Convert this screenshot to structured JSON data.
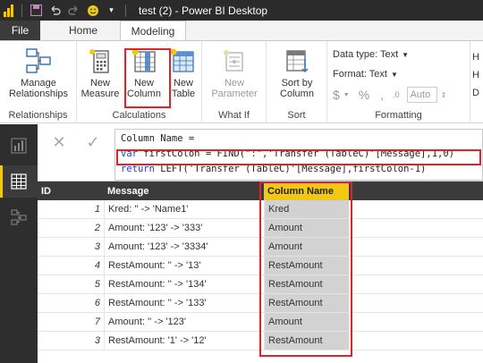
{
  "window": {
    "title": "test (2) - Power BI Desktop"
  },
  "tabs": {
    "file": "File",
    "home": "Home",
    "modeling": "Modeling"
  },
  "ribbon": {
    "relationships": {
      "button": [
        "Manage",
        "Relationships"
      ],
      "group": "Relationships"
    },
    "calculations": {
      "new_measure": [
        "New",
        "Measure"
      ],
      "new_column": [
        "New",
        "Column"
      ],
      "new_table": [
        "New",
        "Table"
      ],
      "group": "Calculations"
    },
    "whatif": {
      "new_parameter": [
        "New",
        "Parameter"
      ],
      "group": "What If"
    },
    "sort": {
      "sort_by_column": [
        "Sort by",
        "Column"
      ],
      "group": "Sort"
    },
    "formatting": {
      "data_type": "Data type: Text",
      "format": "Format: Text",
      "currency": "$",
      "percent": "%",
      "comma": ",",
      "auto": "Auto",
      "group": "Formatting"
    }
  },
  "formula": {
    "cancel_icon": "x-icon",
    "commit_icon": "check-icon",
    "line1": "Column Name =",
    "line2_kw": "var",
    "line2_a": " firstColon = FIND(",
    "line2_str": "\":\"",
    "line2_b": ",'Transfer (TableC)'[Message],1,0)",
    "line3_kw": "return",
    "line3_b": " LEFT('Transfer (TableC)'[Message],firstColon-1)"
  },
  "table": {
    "columns": [
      "ID",
      "Message",
      "Column Name"
    ],
    "rows": [
      {
        "id": "1",
        "message": "Kred: '' -> 'Name1'",
        "column_name": "Kred"
      },
      {
        "id": "2",
        "message": "Amount: '123' -> '333'",
        "column_name": "Amount"
      },
      {
        "id": "3",
        "message": "Amount: '123' -> '3334'",
        "column_name": "Amount"
      },
      {
        "id": "4",
        "message": "RestAmount: '' -> '13'",
        "column_name": "RestAmount"
      },
      {
        "id": "5",
        "message": "RestAmount: '' -> '134'",
        "column_name": "RestAmount"
      },
      {
        "id": "6",
        "message": "RestAmount: '' -> '133'",
        "column_name": "RestAmount"
      },
      {
        "id": "7",
        "message": "Amount: '' -> '123'",
        "column_name": "Amount"
      },
      {
        "id": "3",
        "message": "RestAmount: '1' -> '12'",
        "column_name": "RestAmount"
      }
    ]
  },
  "colors": {
    "accent": "#f2c811",
    "highlight": "#d9262c",
    "dark": "#2b2b2b"
  }
}
